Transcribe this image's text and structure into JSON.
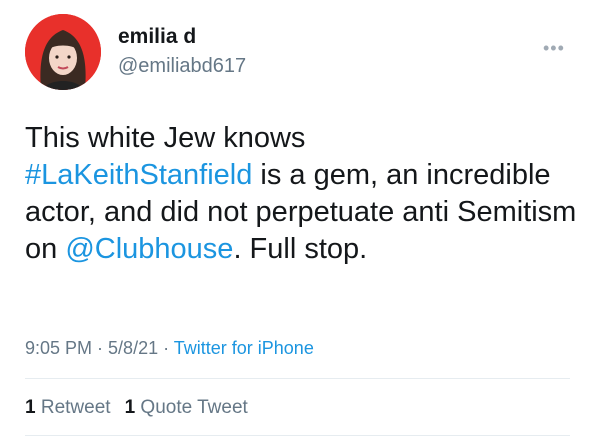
{
  "tweet": {
    "author_name": "emilia d",
    "author_handle": "@emiliabd617",
    "more_icon": "•••",
    "text_parts": [
      "This white Jew knows",
      "#LaKeithStanfield",
      " is a gem, an incredible actor, and did not perpetuate anti Semitism on ",
      "@Clubhouse",
      ". Full stop."
    ],
    "time": "9:05 PM",
    "sep1": " · ",
    "date": "5/8/21",
    "sep2": " · ",
    "source": "Twitter for iPhone",
    "retweet_count": "1",
    "retweet_label": " Retweet",
    "quote_count": "1",
    "quote_label": " Quote Tweet"
  },
  "colors": {
    "link": "#1b95e0",
    "secondary_text": "#657786",
    "avatar_bg": "#e8302b"
  }
}
